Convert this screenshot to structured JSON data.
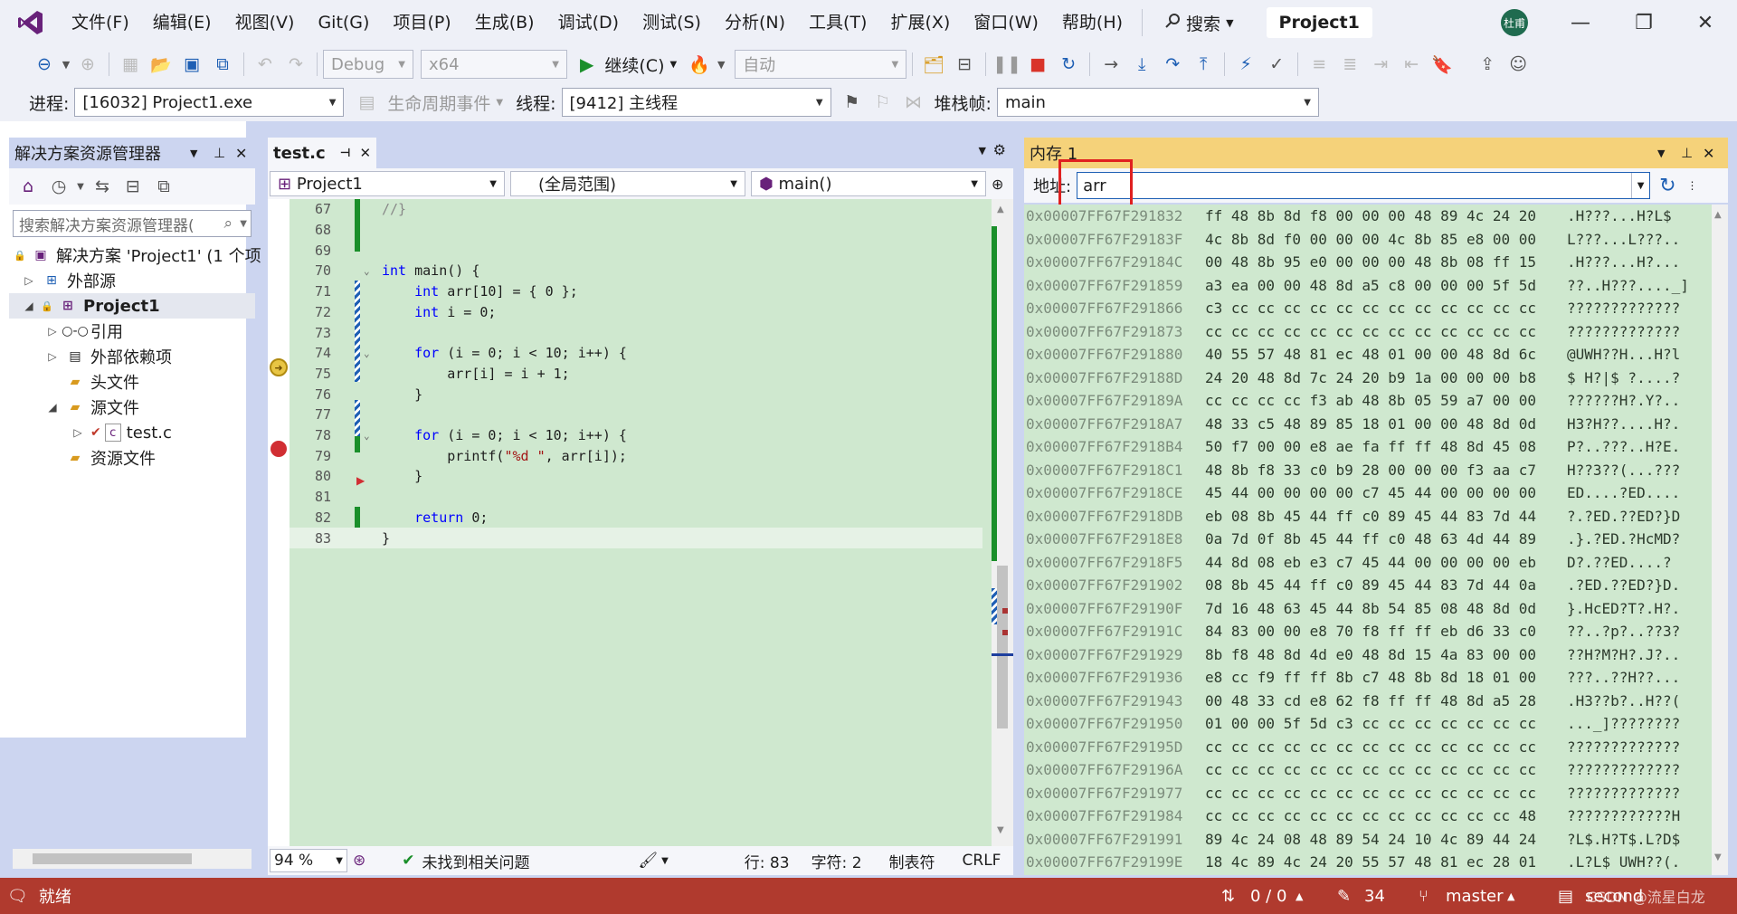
{
  "menubar": {
    "items": [
      "文件(F)",
      "编辑(E)",
      "视图(V)",
      "Git(G)",
      "项目(P)",
      "生成(B)",
      "调试(D)",
      "测试(S)",
      "分析(N)",
      "工具(T)",
      "扩展(X)",
      "窗口(W)",
      "帮助(H)"
    ],
    "search_label": "搜索",
    "solution_name": "Project1",
    "user_initials": "杜甫"
  },
  "toolbar1": {
    "config": "Debug",
    "platform": "x64",
    "continue_label": "继续(C)",
    "auto_combo": "自动"
  },
  "toolbar2": {
    "process_label": "进程:",
    "process_value": "[16032] Project1.exe",
    "lifecycle_label": "生命周期事件",
    "thread_label": "线程:",
    "thread_value": "[9412] 主线程",
    "stackframe_label": "堆栈帧:",
    "stackframe_value": "main"
  },
  "solution_explorer": {
    "title": "解决方案资源管理器",
    "search_placeholder": "搜索解决方案资源管理器(",
    "items": [
      {
        "label": "解决方案 'Project1' (1 个项"
      },
      {
        "label": "外部源"
      },
      {
        "label": "Project1"
      },
      {
        "label": "引用"
      },
      {
        "label": "外部依赖项"
      },
      {
        "label": "头文件"
      },
      {
        "label": "源文件"
      },
      {
        "label": "test.c"
      },
      {
        "label": "资源文件"
      }
    ]
  },
  "editor": {
    "tab_label": "test.c",
    "nav_project": "Project1",
    "nav_scope": "(全局范围)",
    "nav_function": "main()",
    "lines": [
      {
        "num": "67",
        "code": "//}"
      },
      {
        "num": "68",
        "code": ""
      },
      {
        "num": "69",
        "code": ""
      },
      {
        "num": "70",
        "code": "int main() {"
      },
      {
        "num": "71",
        "code": "    int arr[10] = { 0 };"
      },
      {
        "num": "72",
        "code": "    int i = 0;"
      },
      {
        "num": "73",
        "code": ""
      },
      {
        "num": "74",
        "code": "    for (i = 0; i < 10; i++) {"
      },
      {
        "num": "75",
        "code": "        arr[i] = i + 1;"
      },
      {
        "num": "76",
        "code": "    }"
      },
      {
        "num": "77",
        "code": ""
      },
      {
        "num": "78",
        "code": "    for (i = 0; i < 10; i++) {"
      },
      {
        "num": "79",
        "code": "        printf(\"%d \", arr[i]);"
      },
      {
        "num": "80",
        "code": "    }"
      },
      {
        "num": "81",
        "code": ""
      },
      {
        "num": "82",
        "code": "    return 0;"
      },
      {
        "num": "83",
        "code": "}"
      }
    ],
    "zoom": "94 %",
    "issues_label": "未找到相关问题",
    "line_label": "行: 83",
    "char_label": "字符: 2",
    "tab_mode": "制表符",
    "line_ending": "CRLF"
  },
  "memory": {
    "title": "内存 1",
    "address_label": "地址:",
    "address_value": "arr",
    "rows": [
      {
        "addr": "0x00007FF67F291832",
        "bytes": "ff 48 8b 8d f8 00 00 00 48 89 4c 24 20",
        "ascii": ".H???...H?L$"
      },
      {
        "addr": "0x00007FF67F29183F",
        "bytes": "4c 8b 8d f0 00 00 00 4c 8b 85 e8 00 00",
        "ascii": "L???...L???.."
      },
      {
        "addr": "0x00007FF67F29184C",
        "bytes": "00 48 8b 95 e0 00 00 00 48 8b 08 ff 15",
        "ascii": ".H???...H?..."
      },
      {
        "addr": "0x00007FF67F291859",
        "bytes": "a3 ea 00 00 48 8d a5 c8 00 00 00 5f 5d",
        "ascii": "??..H???...._]"
      },
      {
        "addr": "0x00007FF67F291866",
        "bytes": "c3 cc cc cc cc cc cc cc cc cc cc cc cc",
        "ascii": "?????????????"
      },
      {
        "addr": "0x00007FF67F291873",
        "bytes": "cc cc cc cc cc cc cc cc cc cc cc cc cc",
        "ascii": "?????????????"
      },
      {
        "addr": "0x00007FF67F291880",
        "bytes": "40 55 57 48 81 ec 48 01 00 00 48 8d 6c",
        "ascii": "@UWH??H...H?l"
      },
      {
        "addr": "0x00007FF67F29188D",
        "bytes": "24 20 48 8d 7c 24 20 b9 1a 00 00 00 b8",
        "ascii": "$ H?|$ ?....?"
      },
      {
        "addr": "0x00007FF67F29189A",
        "bytes": "cc cc cc cc f3 ab 48 8b 05 59 a7 00 00",
        "ascii": "??????H?.Y?.."
      },
      {
        "addr": "0x00007FF67F2918A7",
        "bytes": "48 33 c5 48 89 85 18 01 00 00 48 8d 0d",
        "ascii": "H3?H??....H?."
      },
      {
        "addr": "0x00007FF67F2918B4",
        "bytes": "50 f7 00 00 e8 ae fa ff ff 48 8d 45 08",
        "ascii": "P?..???..H?E."
      },
      {
        "addr": "0x00007FF67F2918C1",
        "bytes": "48 8b f8 33 c0 b9 28 00 00 00 f3 aa c7",
        "ascii": "H??3??(...???"
      },
      {
        "addr": "0x00007FF67F2918CE",
        "bytes": "45 44 00 00 00 00 c7 45 44 00 00 00 00",
        "ascii": "ED....?ED...."
      },
      {
        "addr": "0x00007FF67F2918DB",
        "bytes": "eb 08 8b 45 44 ff c0 89 45 44 83 7d 44",
        "ascii": "?.?ED.??ED?}D"
      },
      {
        "addr": "0x00007FF67F2918E8",
        "bytes": "0a 7d 0f 8b 45 44 ff c0 48 63 4d 44 89",
        "ascii": ".}.?ED.?HcMD?"
      },
      {
        "addr": "0x00007FF67F2918F5",
        "bytes": "44 8d 08 eb e3 c7 45 44 00 00 00 00 eb",
        "ascii": "D?.??ED....?"
      },
      {
        "addr": "0x00007FF67F291902",
        "bytes": "08 8b 45 44 ff c0 89 45 44 83 7d 44 0a",
        "ascii": ".?ED.??ED?}D."
      },
      {
        "addr": "0x00007FF67F29190F",
        "bytes": "7d 16 48 63 45 44 8b 54 85 08 48 8d 0d",
        "ascii": "}.HcED?T?.H?."
      },
      {
        "addr": "0x00007FF67F29191C",
        "bytes": "84 83 00 00 e8 70 f8 ff ff eb d6 33 c0",
        "ascii": "??..?p?..??3?"
      },
      {
        "addr": "0x00007FF67F291929",
        "bytes": "8b f8 48 8d 4d e0 48 8d 15 4a 83 00 00",
        "ascii": "??H?M?H?.J?.."
      },
      {
        "addr": "0x00007FF67F291936",
        "bytes": "e8 cc f9 ff ff 8b c7 48 8b 8d 18 01 00",
        "ascii": "???..??H??..."
      },
      {
        "addr": "0x00007FF67F291943",
        "bytes": "00 48 33 cd e8 62 f8 ff ff 48 8d a5 28",
        "ascii": ".H3??b?..H??("
      },
      {
        "addr": "0x00007FF67F291950",
        "bytes": "01 00 00 5f 5d c3 cc cc cc cc cc cc cc",
        "ascii": "..._]????????"
      },
      {
        "addr": "0x00007FF67F29195D",
        "bytes": "cc cc cc cc cc cc cc cc cc cc cc cc cc",
        "ascii": "?????????????"
      },
      {
        "addr": "0x00007FF67F29196A",
        "bytes": "cc cc cc cc cc cc cc cc cc cc cc cc cc",
        "ascii": "?????????????"
      },
      {
        "addr": "0x00007FF67F291977",
        "bytes": "cc cc cc cc cc cc cc cc cc cc cc cc cc",
        "ascii": "?????????????"
      },
      {
        "addr": "0x00007FF67F291984",
        "bytes": "cc cc cc cc cc cc cc cc cc cc cc cc 48",
        "ascii": "????????????H"
      },
      {
        "addr": "0x00007FF67F291991",
        "bytes": "89 4c 24 08 48 89 54 24 10 4c 89 44 24",
        "ascii": "?L$.H?T$.L?D$"
      },
      {
        "addr": "0x00007FF67F29199E",
        "bytes": "18 4c 89 4c 24 20 55 57 48 81 ec 28 01",
        "ascii": ".L?L$ UWH??(."
      }
    ]
  },
  "statusbar": {
    "ready": "就绪",
    "changes": "0 / 0",
    "edits": "34",
    "branch": "master",
    "repo": "second",
    "watermark": "CSDN @流星白龙"
  },
  "colors": {
    "accent": "#68217a",
    "statusbar": "#b03a2e",
    "memory_header": "#f5d27a",
    "editor_bg": "#cfe8cf",
    "address_highlight": "#e02020"
  }
}
